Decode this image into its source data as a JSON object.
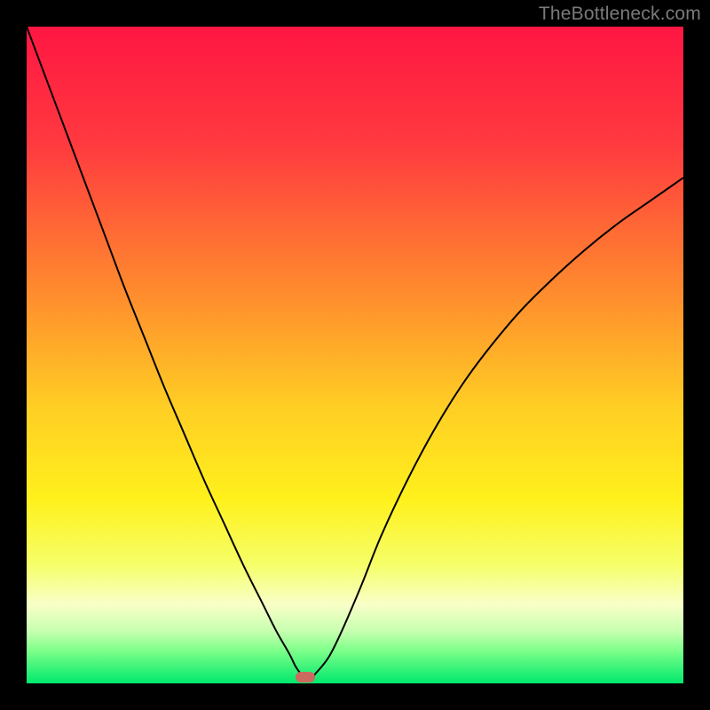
{
  "watermark": {
    "text": "TheBottleneck.com"
  },
  "chart_data": {
    "type": "line",
    "title": "",
    "xlabel": "",
    "ylabel": "",
    "xlim": [
      0,
      100
    ],
    "ylim": [
      0,
      100
    ],
    "gradient_stops": [
      {
        "offset": 0,
        "color": "#ff1643"
      },
      {
        "offset": 18,
        "color": "#ff3a3f"
      },
      {
        "offset": 40,
        "color": "#ff8a2e"
      },
      {
        "offset": 58,
        "color": "#ffce24"
      },
      {
        "offset": 72,
        "color": "#fff11c"
      },
      {
        "offset": 82,
        "color": "#f6ff6a"
      },
      {
        "offset": 88,
        "color": "#f8ffc8"
      },
      {
        "offset": 92,
        "color": "#c8ffb0"
      },
      {
        "offset": 95,
        "color": "#7dff8a"
      },
      {
        "offset": 100,
        "color": "#00e96c"
      }
    ],
    "series": [
      {
        "name": "bottleneck-curve",
        "color": "#000000",
        "width": 2,
        "x": [
          0,
          3,
          6,
          9,
          12,
          15,
          18,
          21,
          24,
          27,
          30,
          33,
          36,
          38,
          40,
          41,
          42,
          43,
          44,
          46,
          48,
          51,
          54,
          58,
          62,
          66,
          70,
          75,
          80,
          85,
          90,
          95,
          100
        ],
        "y": [
          100,
          92,
          84,
          76,
          68,
          60,
          52.5,
          45,
          38,
          31,
          24.5,
          18,
          12,
          8,
          4.5,
          2.5,
          1.2,
          0.5,
          1.5,
          4,
          8,
          15,
          22.5,
          31,
          38.5,
          45,
          50.5,
          56.5,
          61.5,
          66,
          70,
          73.5,
          77
        ]
      }
    ],
    "marker": {
      "x": 42.4,
      "y": 0.9,
      "color": "#cc6a60"
    }
  }
}
